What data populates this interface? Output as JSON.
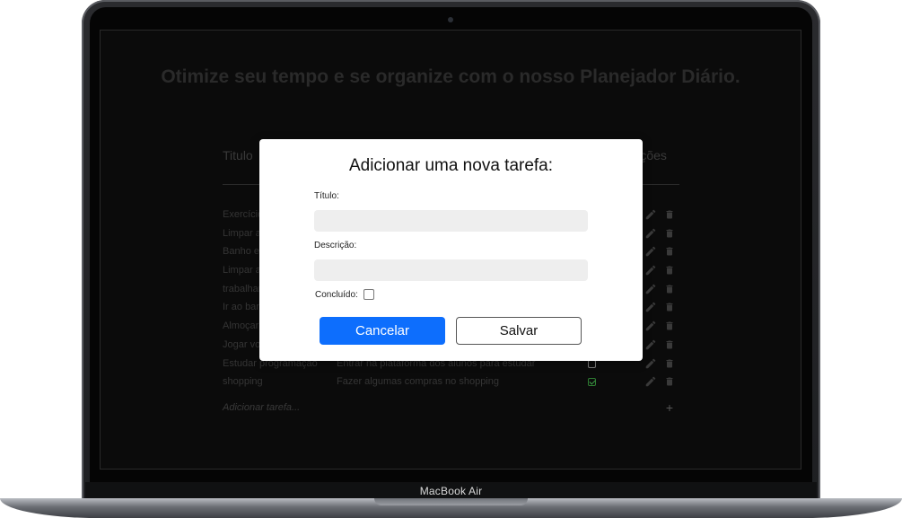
{
  "device": {
    "label": "MacBook Air"
  },
  "page": {
    "headline": "Otimize seu tempo e se organize com o nosso Planejador Diário.",
    "columns": {
      "title": "Titulo",
      "actions": "Ações"
    },
    "rows": [
      {
        "title": "Exercício",
        "desc": "",
        "done": false
      },
      {
        "title": "Limpar a",
        "desc": "",
        "done": false
      },
      {
        "title": "Banho e",
        "desc": "",
        "done": false
      },
      {
        "title": "Limpar a",
        "desc": "",
        "done": false
      },
      {
        "title": "trabalhar",
        "desc": "",
        "done": false
      },
      {
        "title": "Ir ao ban",
        "desc": "",
        "done": false
      },
      {
        "title": "Almoçar",
        "desc": "",
        "done": false
      },
      {
        "title": "Jogar vo",
        "desc": "",
        "done": false
      },
      {
        "title": "Estudar programação",
        "desc": "Entrar na plataforma dos alunos para estudar",
        "done": false
      },
      {
        "title": "shopping",
        "desc": "Fazer algumas compras no shopping",
        "done": true
      }
    ],
    "add_task": "Adicionar tarefa...",
    "add_plus": "+"
  },
  "modal": {
    "title": "Adicionar uma nova tarefa:",
    "title_label": "Título:",
    "title_value": "",
    "desc_label": "Descrição:",
    "desc_value": "",
    "done_label": "Concluído:",
    "cancel_label": "Cancelar",
    "save_label": "Salvar"
  },
  "colors": {
    "primary": "#0d6efd",
    "done_check": "#3fa34a",
    "screen_bg": "#0b0b0b"
  }
}
